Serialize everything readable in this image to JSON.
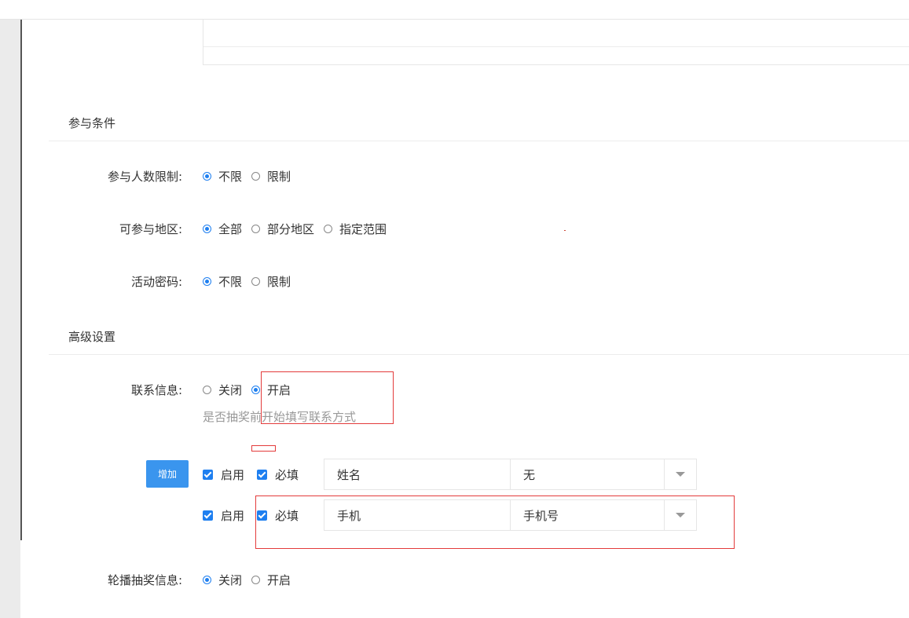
{
  "sections": {
    "participation": "参与条件",
    "advanced": "高级设置"
  },
  "fields": {
    "participant_limit": {
      "label": "参与人数限制:",
      "options": [
        "不限",
        "限制"
      ],
      "selected": "不限"
    },
    "region": {
      "label": "可参与地区:",
      "options": [
        "全部",
        "部分地区",
        "指定范围"
      ],
      "selected": "全部"
    },
    "password": {
      "label": "活动密码:",
      "options": [
        "不限",
        "限制"
      ],
      "selected": "不限"
    },
    "contact_info": {
      "label": "联系信息:",
      "options": [
        "关闭",
        "开启"
      ],
      "selected": "开启",
      "hint": "是否抽奖前开始填写联系方式"
    },
    "carousel": {
      "label": "轮播抽奖信息:",
      "options": [
        "关闭",
        "开启"
      ],
      "selected": "关闭"
    }
  },
  "contact_rows": {
    "add_label": "增加",
    "rows": [
      {
        "enable_label": "启用",
        "enabled": true,
        "required_label": "必填",
        "required": true,
        "name": "姓名",
        "validation": "无"
      },
      {
        "enable_label": "启用",
        "enabled": true,
        "required_label": "必填",
        "required": true,
        "name": "手机",
        "validation": "手机号"
      }
    ]
  },
  "colors": {
    "accent": "#1e7ff0",
    "button": "#3a95ee",
    "annotation": "#e33b3b"
  }
}
